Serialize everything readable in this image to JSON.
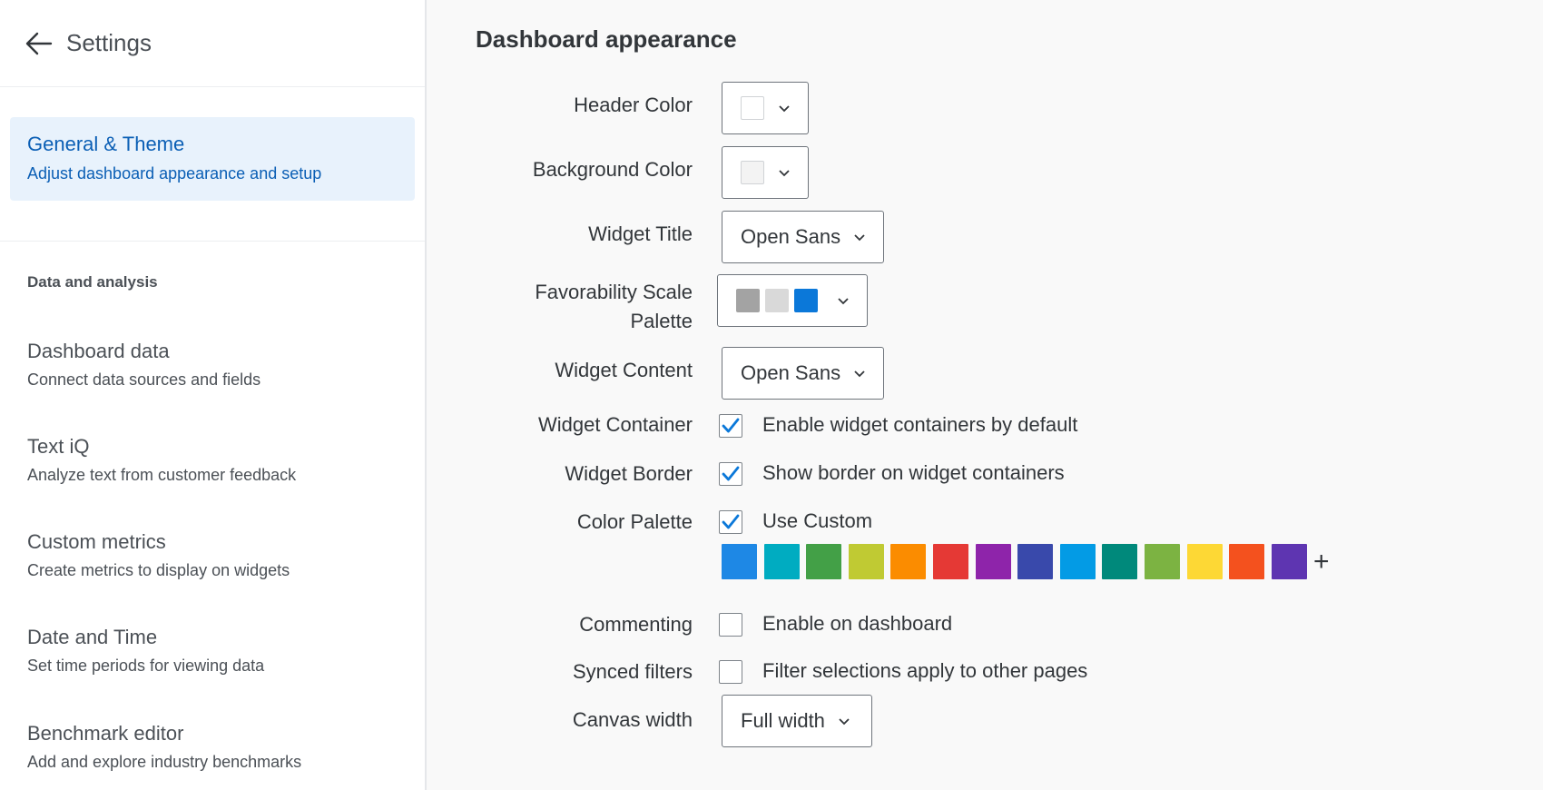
{
  "sidebar": {
    "title": "Settings",
    "active": {
      "title": "General & Theme",
      "subtitle": "Adjust dashboard appearance and setup"
    },
    "section_label": "Data and analysis",
    "items": [
      {
        "title": "Dashboard data",
        "subtitle": "Connect data sources and fields"
      },
      {
        "title": "Text iQ",
        "subtitle": "Analyze text from customer feedback"
      },
      {
        "title": "Custom metrics",
        "subtitle": "Create metrics to display on widgets"
      },
      {
        "title": "Date and Time",
        "subtitle": "Set time periods for viewing data"
      },
      {
        "title": "Benchmark editor",
        "subtitle": "Add and explore industry benchmarks"
      }
    ]
  },
  "main": {
    "title": "Dashboard appearance",
    "header_color": {
      "label": "Header Color",
      "value": "#ffffff"
    },
    "background_color": {
      "label": "Background Color",
      "value": "#f3f3f3"
    },
    "widget_title": {
      "label": "Widget Title",
      "value": "Open Sans"
    },
    "favorability": {
      "label_line1": "Favorability Scale",
      "label_line2": "Palette",
      "colors": [
        "#a3a3a3",
        "#d9d9d9",
        "#0b78d9"
      ]
    },
    "widget_content": {
      "label": "Widget Content",
      "value": "Open Sans"
    },
    "widget_container": {
      "label": "Widget Container",
      "option": "Enable widget containers by default",
      "checked": true
    },
    "widget_border": {
      "label": "Widget Border",
      "option": "Show border on widget containers",
      "checked": true
    },
    "color_palette": {
      "label": "Color Palette",
      "option": "Use Custom",
      "checked": true,
      "colors": [
        "#1e88e5",
        "#00acc1",
        "#43a047",
        "#c0ca33",
        "#fb8c00",
        "#e53935",
        "#8e24aa",
        "#3949ab",
        "#039be5",
        "#00897b",
        "#7cb342",
        "#fdd835",
        "#f4511e",
        "#5e35b1"
      ],
      "add_symbol": "+"
    },
    "commenting": {
      "label": "Commenting",
      "option": "Enable on dashboard",
      "checked": false
    },
    "synced_filters": {
      "label": "Synced filters",
      "option": "Filter selections apply to other pages",
      "checked": false
    },
    "canvas_width": {
      "label": "Canvas width",
      "value": "Full width"
    }
  },
  "colors": {
    "accent": "#0b5fb5",
    "active_bg": "#e8f2fc",
    "check": "#0b78d9"
  }
}
